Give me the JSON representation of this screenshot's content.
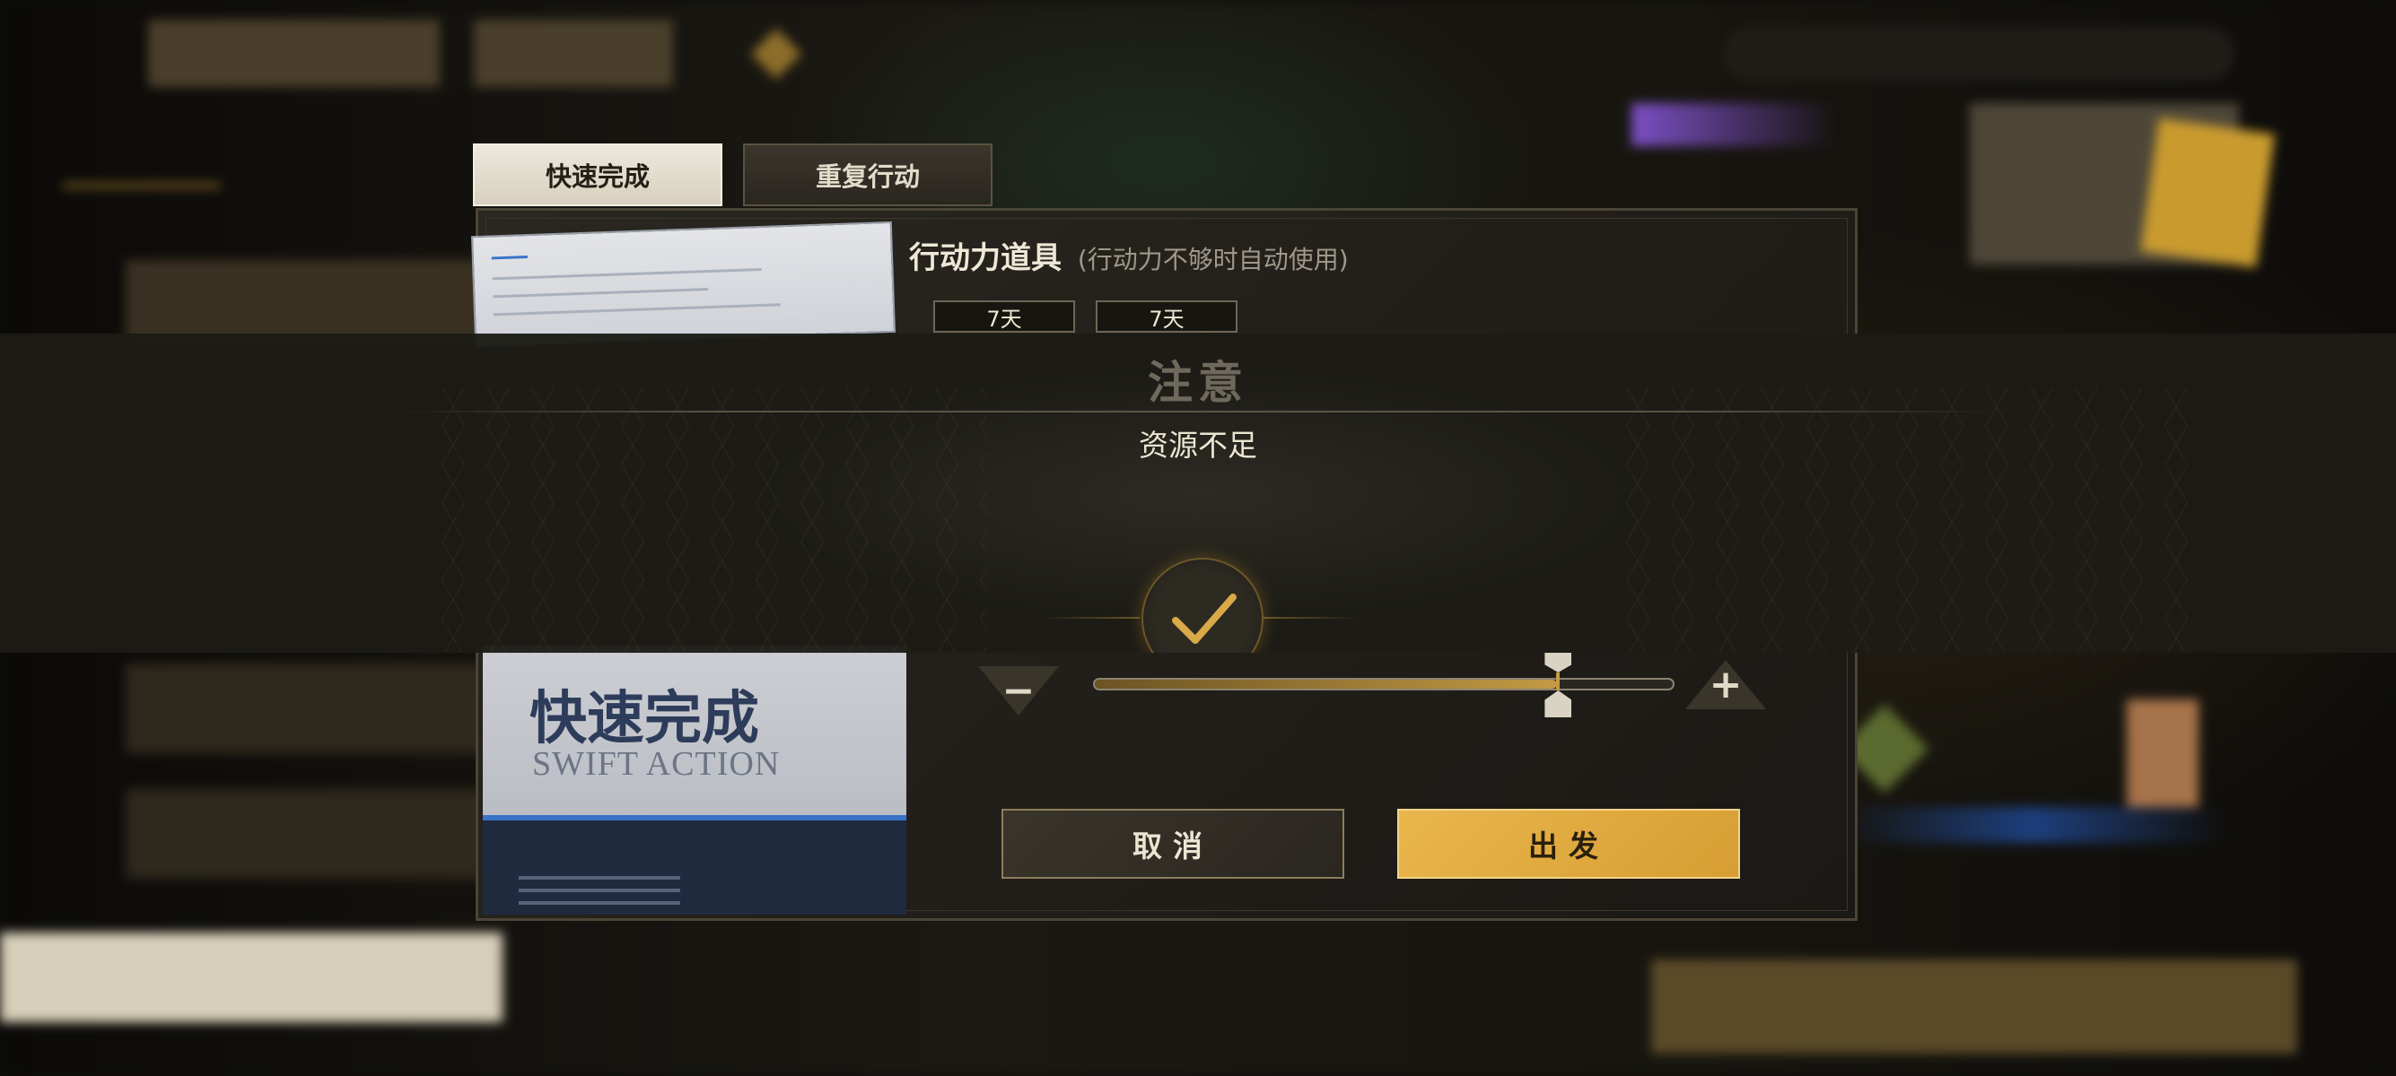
{
  "tabs": {
    "quick_complete": "快速完成",
    "repeat_action": "重复行动"
  },
  "panel": {
    "item_title": "行动力道具",
    "item_hint": "(行动力不够时自动使用)",
    "chips": [
      "7天",
      "7天"
    ],
    "card_title_cn": "快速完成",
    "card_title_en": "SWIFT ACTION"
  },
  "slider": {
    "value_fraction": 0.8,
    "minus_label": "−",
    "plus_label": "+"
  },
  "buttons": {
    "cancel": "取消",
    "depart": "出发"
  },
  "notice": {
    "title": "注意",
    "message": "资源不足"
  },
  "icons": {
    "confirm": "checkmark-icon",
    "minus": "minus-icon",
    "plus": "plus-icon"
  },
  "colors": {
    "accent_gold": "#e9b64d",
    "panel_bg": "#221f1a",
    "banner_bg": "#1c1b16"
  }
}
